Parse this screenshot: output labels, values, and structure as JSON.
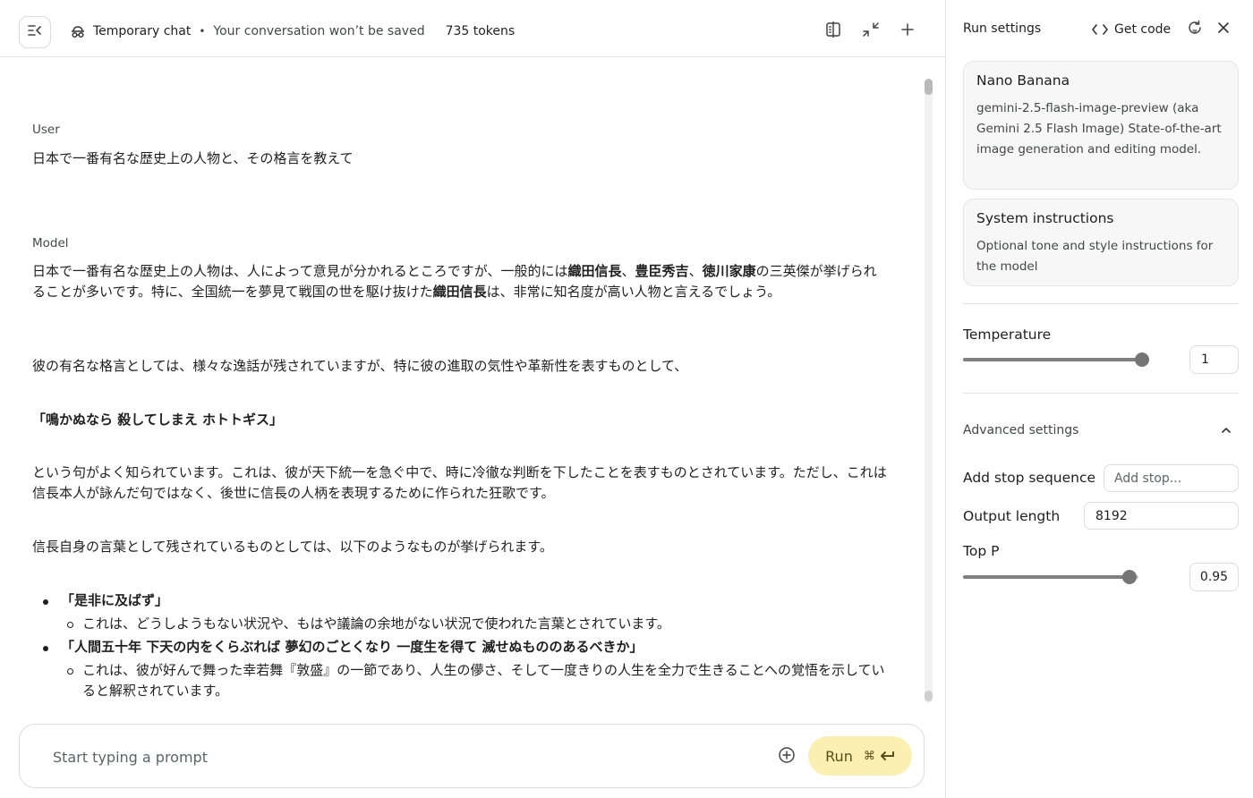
{
  "header": {
    "chat_label": "Temporary chat",
    "separator": "•",
    "notice": "Your conversation won’t be saved",
    "tokens": "735 tokens",
    "icons": [
      "menu-collapse-icon",
      "ghost-icon",
      "compare-icon",
      "compress-icon",
      "plus-icon"
    ]
  },
  "conversation": {
    "user_role": "User",
    "user_text": "日本で一番有名な歴史上の人物と、その格言を教えて",
    "model_role": "Model",
    "p1": [
      {
        "t": "日本で一番有名な歴史上の人物は、人によって意見が分かれるところですが、一般的には",
        "b": false
      },
      {
        "t": "織田信長",
        "b": true
      },
      {
        "t": "、",
        "b": false
      },
      {
        "t": "豊臣秀吉",
        "b": true
      },
      {
        "t": "、",
        "b": false
      },
      {
        "t": "徳川家康",
        "b": true
      },
      {
        "t": "の三英傑が挙げられることが多いです。特に、全国統一を夢見て戦国の世を駆け抜けた",
        "b": false
      },
      {
        "t": "織田信長",
        "b": true
      },
      {
        "t": "は、非常に知名度が高い人物と言えるでしょう。",
        "b": false
      }
    ],
    "p2": "彼の有名な格言としては、様々な逸話が残されていますが、特に彼の進取の気性や革新性を表すものとして、",
    "quote": "「鳴かぬなら 殺してしまえ ホトトギス」",
    "p3": "という句がよく知られています。これは、彼が天下統一を急ぐ中で、時に冷徹な判断を下したことを表すものとされています。ただし、これは信長本人が詠んだ句ではなく、後世に信長の人柄を表現するために作られた狂歌です。",
    "p4": "信長自身の言葉として残されているものとしては、以下のようなものが挙げられます。",
    "bullets": [
      {
        "title": "「是非に及ばず」",
        "detail": "これは、どうしようもない状況や、もはや議論の余地がない状況で使われた言葉とされています。"
      },
      {
        "title": "「人間五十年 下天の内をくらぶれば 夢幻のごとくなり 一度生を得て 滅せぬもののあるべきか」",
        "detail": "これは、彼が好んで舞った幸若舞『敦盛』の一節であり、人生の儚さ、そして一度きりの人生を全力で生きることへの覚悟を示していると解釈されています。"
      }
    ]
  },
  "prompt": {
    "placeholder": "Start typing a prompt",
    "run_label": "Run",
    "shortcut": "⌘"
  },
  "panel": {
    "title": "Run settings",
    "get_code": "Get code",
    "model_card": {
      "name": "Nano Banana",
      "desc": "gemini-2.5-flash-image-preview (aka Gemini 2.5 Flash Image) State-of-the-art image generation and editing model."
    },
    "system_card": {
      "title": "System instructions",
      "desc": "Optional tone and style instructions for the model"
    },
    "temperature": {
      "label": "Temperature",
      "value": "1",
      "fraction": 1.0
    },
    "advanced_label": "Advanced settings",
    "stop_sequence": {
      "label": "Add stop sequence",
      "placeholder": "Add stop..."
    },
    "output_length": {
      "label": "Output length",
      "value": "8192"
    },
    "top_p": {
      "label": "Top P",
      "value": "0.95",
      "fraction": 0.95
    }
  }
}
